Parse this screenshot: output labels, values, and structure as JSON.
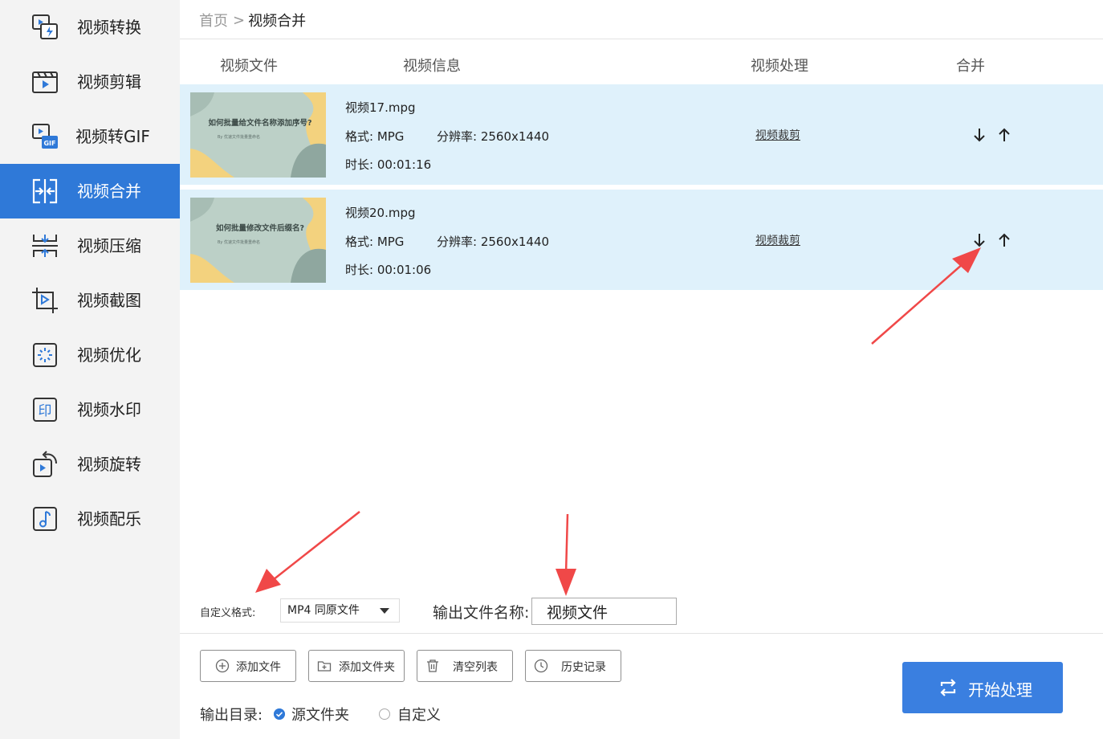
{
  "sidebar": {
    "items": [
      {
        "label": "视频转换",
        "icon": "video-convert-icon"
      },
      {
        "label": "视频剪辑",
        "icon": "video-edit-icon"
      },
      {
        "label": "视频转GIF",
        "icon": "gif-icon"
      },
      {
        "label": "视频合并",
        "icon": "video-merge-icon",
        "active": true
      },
      {
        "label": "视频压缩",
        "icon": "compress-icon"
      },
      {
        "label": "视频截图",
        "icon": "screenshot-icon"
      },
      {
        "label": "视频优化",
        "icon": "optimize-icon"
      },
      {
        "label": "视频水印",
        "icon": "watermark-icon"
      },
      {
        "label": "视频旋转",
        "icon": "rotate-icon"
      },
      {
        "label": "视频配乐",
        "icon": "music-icon"
      }
    ]
  },
  "breadcrumb": {
    "home": "首页",
    "separator": ">",
    "current": "视频合并"
  },
  "table": {
    "headers": {
      "file": "视频文件",
      "info": "视频信息",
      "process": "视频处理",
      "merge": "合并"
    },
    "rows": [
      {
        "thumb_title": "如何批量给文件名称添加序号?",
        "thumb_sub": "By 优速文件批量重命名",
        "filename": "视频17.mpg",
        "format": "格式: MPG",
        "resolution": "分辨率: 2560x1440",
        "duration": "时长: 00:01:16",
        "process_link": "视频裁剪"
      },
      {
        "thumb_title": "如何批量修改文件后缀名?",
        "thumb_sub": "By 优速文件批量重命名",
        "filename": "视频20.mpg",
        "format": "格式: MPG",
        "resolution": "分辨率: 2560x1440",
        "duration": "时长: 00:01:06",
        "process_link": "视频裁剪"
      }
    ]
  },
  "options": {
    "format_label": "自定义格式:",
    "format_value": "MP4 同原文件",
    "output_name_label": "输出文件名称:",
    "output_name_value": "视频文件"
  },
  "toolbar": {
    "add_file": "添加文件",
    "add_folder": "添加文件夹",
    "clear_list": "清空列表",
    "history": "历史记录"
  },
  "output_dir": {
    "label": "输出目录:",
    "source_folder": "源文件夹",
    "custom": "自定义",
    "selected": "source_folder"
  },
  "start_button": "开始处理",
  "colors": {
    "accent": "#2f79d8",
    "row_bg": "#dff1fb",
    "annotation": "#f04848"
  }
}
